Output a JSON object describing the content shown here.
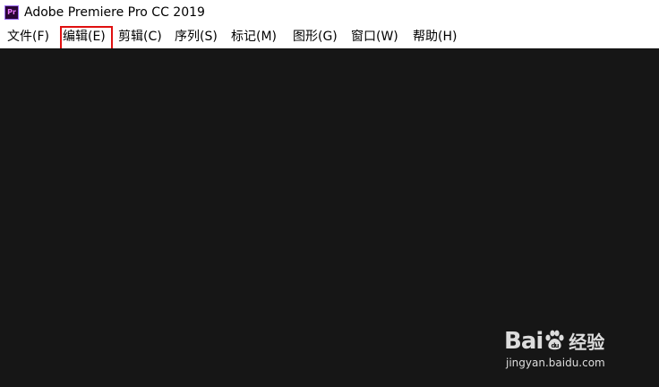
{
  "titlebar": {
    "app_icon_text": "Pr",
    "title": "Adobe Premiere Pro CC 2019"
  },
  "menubar": {
    "items": [
      {
        "label": "文件(F)"
      },
      {
        "label": "编辑(E)"
      },
      {
        "label": "剪辑(C)"
      },
      {
        "label": "序列(S)"
      },
      {
        "label": "标记(M)"
      },
      {
        "label": "图形(G)"
      },
      {
        "label": "窗口(W)"
      },
      {
        "label": "帮助(H)"
      }
    ]
  },
  "watermark": {
    "brand_left": "Bai",
    "brand_right": "经验",
    "url": "jingyan.baidu.com"
  },
  "colors": {
    "workspace_bg": "#161616",
    "highlight": "#e01010",
    "app_icon_bg": "#2a0634",
    "app_icon_fg": "#ea77ff"
  }
}
